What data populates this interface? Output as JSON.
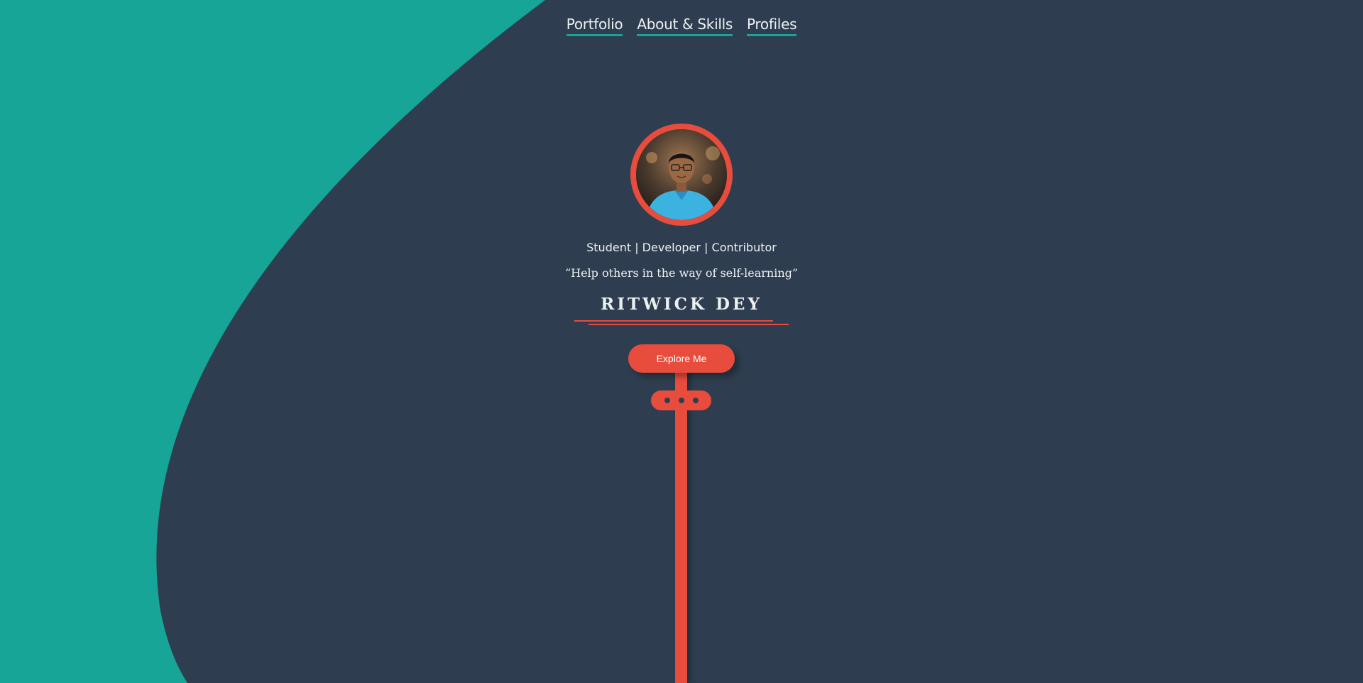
{
  "nav": {
    "items": [
      {
        "label": "Portfolio"
      },
      {
        "label": "About & Skills"
      },
      {
        "label": "Profiles"
      }
    ]
  },
  "profile": {
    "subtitle": "Student | Developer | Contributor",
    "quote": "“Help others in the way of self-learning”",
    "name": "RITWICK DEY"
  },
  "cta": {
    "label": "Explore Me"
  },
  "colors": {
    "background": "#2e3e50",
    "wave": "#16a596",
    "accent": "#e74c3c",
    "text": "#ecf0f1"
  },
  "icons": {
    "more": "more-dots-icon"
  }
}
